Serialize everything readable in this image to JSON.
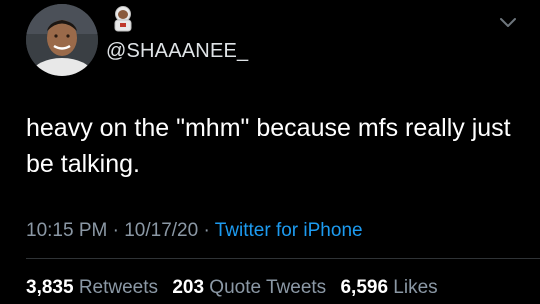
{
  "tweet": {
    "handle": "@SHAAANEE_",
    "text": "heavy on the \"mhm\" because mfs really just be talking.",
    "time": "10:15 PM",
    "date": "10/17/20",
    "separator": "·",
    "source": "Twitter for iPhone",
    "display_name_icon": "astronaut-emoji",
    "avatar_icon": "profile-photo",
    "menu_icon": "chevron-down-icon"
  },
  "stats": {
    "retweets_count": "3,835",
    "retweets_label": "Retweets",
    "quote_tweets_count": "203",
    "quote_tweets_label": "Quote Tweets",
    "likes_count": "6,596",
    "likes_label": "Likes"
  },
  "colors": {
    "background": "#000000",
    "text": "#ffffff",
    "secondary": "#8b98a5",
    "link": "#1d9bf0",
    "divider": "#2f3336"
  }
}
